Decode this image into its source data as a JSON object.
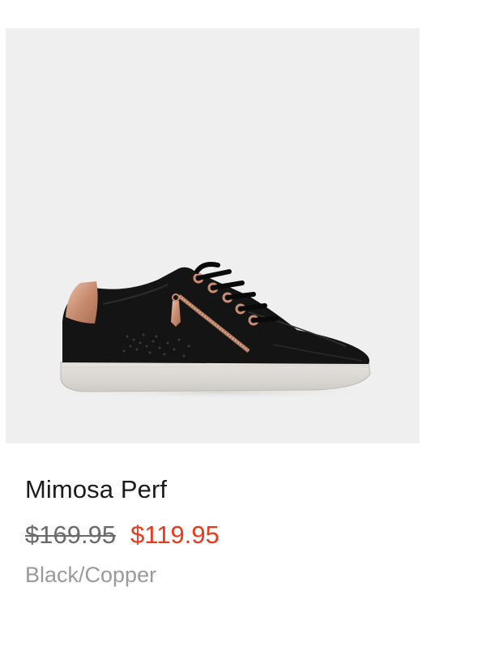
{
  "product": {
    "name": "Mimosa Perf",
    "price_original": "$169.95",
    "price_sale": "$119.95",
    "color": "Black/Copper",
    "image_icon": "sneaker-image"
  },
  "colors": {
    "image_background": "#efefef",
    "name_text": "#1b1b1b",
    "original_price_text": "#6b6b6b",
    "sale_price_text": "#e8391c",
    "color_text": "#9a9a9a"
  }
}
